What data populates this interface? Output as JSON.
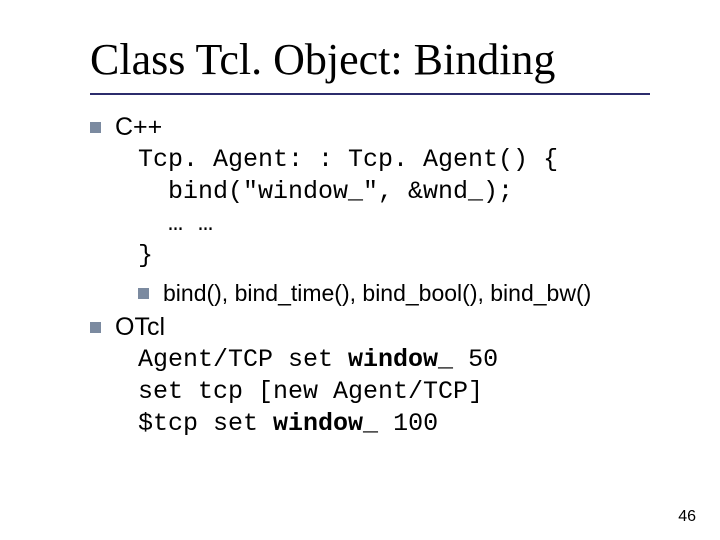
{
  "title": "Class Tcl. Object: Binding",
  "section1": {
    "label": "C++",
    "code_l1": "Tcp. Agent: : Tcp. Agent() {",
    "code_l2": "  bind(\"window_\", &wnd_);",
    "code_l3": "  … …",
    "code_l4": "}",
    "sub_label": "bind(), bind_time(), bind_bool(), bind_bw()"
  },
  "section2": {
    "label": "OTcl",
    "code_l1a": "Agent/TCP set ",
    "code_l1b": "window_",
    "code_l1c": " 50",
    "code_l2": "set tcp [new Agent/TCP]",
    "code_l3a": "$tcp set ",
    "code_l3b": "window_",
    "code_l3c": " 100"
  },
  "page_number": "46"
}
